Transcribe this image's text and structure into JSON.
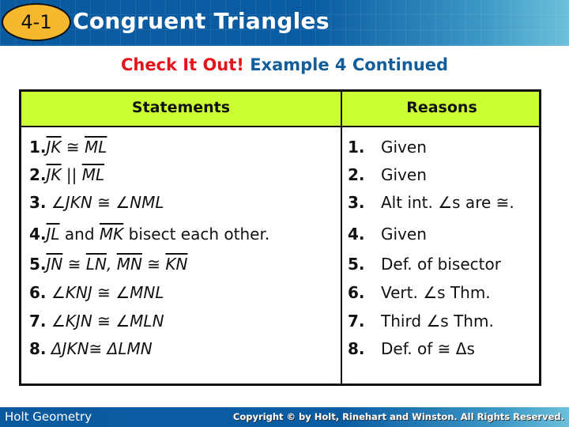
{
  "header": {
    "badge": "4-1",
    "title": "Congruent Triangles"
  },
  "subtitle": {
    "highlight": "Check It Out!",
    "rest": "Example 4 Continued"
  },
  "table": {
    "headers": {
      "statements": "Statements",
      "reasons": "Reasons"
    },
    "statements": [
      {
        "num": "1.",
        "parts": [
          {
            "t": "JK",
            "ov": true
          },
          {
            "t": " ≅ "
          },
          {
            "t": "ML",
            "ov": true
          }
        ]
      },
      {
        "num": "2.",
        "parts": [
          {
            "t": "JK",
            "ov": true
          },
          {
            "t": " || "
          },
          {
            "t": "ML",
            "ov": true
          }
        ]
      },
      {
        "num": "3.",
        "parts": [
          {
            "t": " ∠JKN ≅ ∠NML"
          }
        ]
      },
      {
        "num": "4.",
        "parts": [
          {
            "t": "JL",
            "ov": true
          },
          {
            "t": " and ",
            "plain": true
          },
          {
            "t": "MK",
            "ov": true
          },
          {
            "t": " bisect each other.",
            "plain": true
          }
        ]
      },
      {
        "num": "5.",
        "parts": [
          {
            "t": "JN",
            "ov": true
          },
          {
            "t": " ≅ "
          },
          {
            "t": "LN",
            "ov": true
          },
          {
            "t": ", "
          },
          {
            "t": "MN",
            "ov": true
          },
          {
            "t": " ≅ "
          },
          {
            "t": "KN",
            "ov": true
          }
        ]
      },
      {
        "num": "6.",
        "parts": [
          {
            "t": " ∠KNJ ≅ ∠MNL"
          }
        ]
      },
      {
        "num": "7.",
        "parts": [
          {
            "t": " ∠KJN ≅ ∠MLN"
          }
        ]
      },
      {
        "num": "8.",
        "parts": [
          {
            "t": " ΔJKN≅ ΔLMN"
          }
        ]
      }
    ],
    "reasons": [
      {
        "num": "1.",
        "text": "Given"
      },
      {
        "num": "2.",
        "text": "Given"
      },
      {
        "num": "3.",
        "text": "Alt int. ∠s are ≅."
      },
      {
        "num": "4.",
        "text": "Given"
      },
      {
        "num": "5.",
        "text": "Def. of bisector"
      },
      {
        "num": "6.",
        "text": "Vert. ∠s Thm."
      },
      {
        "num": "7.",
        "text": "Third ∠s Thm."
      },
      {
        "num": "8.",
        "text": "Def. of ≅ Δs"
      }
    ]
  },
  "footer": {
    "left": "Holt Geometry",
    "right": "Copyright © by Holt, Rinehart and Winston. All Rights Reserved."
  }
}
